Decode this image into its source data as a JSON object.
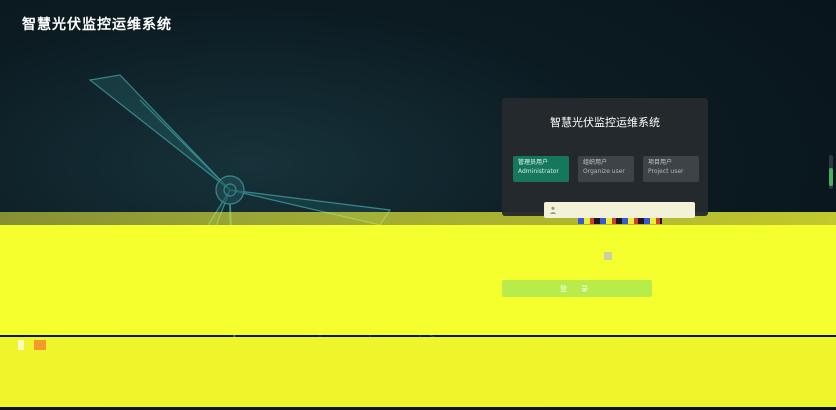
{
  "app": {
    "title": "智慧光伏监控运维系统"
  },
  "login_panel": {
    "title": "智慧光伏监控运维系统",
    "roles": [
      {
        "label_zh": "管理员用户",
        "label_en": "Administrator",
        "active": true
      },
      {
        "label_zh": "组织用户",
        "label_en": "Organize user",
        "active": false
      },
      {
        "label_zh": "项目用户",
        "label_en": "Project user",
        "active": false
      }
    ],
    "username_placeholder": "",
    "login_label": "登 录"
  },
  "colors": {
    "accent": "#16775f",
    "button": "#b8ec4b",
    "panel": "#262a2e"
  }
}
